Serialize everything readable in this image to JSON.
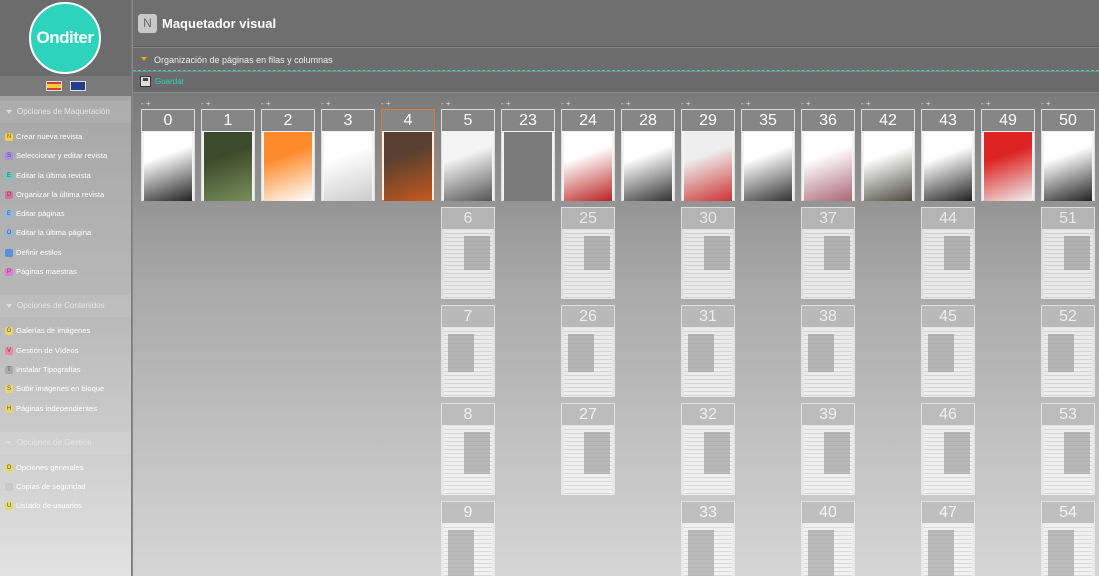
{
  "sidebar": {
    "logo_text": "Onditer",
    "sections": [
      {
        "title": "Opciones de Maquetación",
        "items": [
          {
            "label": "Crear nueva revista",
            "color": "#f1d24a",
            "glyph": "N"
          },
          {
            "label": "Seleccionar y editar revista",
            "color": "#a48fe0",
            "glyph": "S"
          },
          {
            "label": "Editar la última revista",
            "color": "#6fc7c1",
            "glyph": "E"
          },
          {
            "label": "Organizar la última revista",
            "color": "#d86fa2",
            "glyph": "O"
          },
          {
            "label": "Editar páginas",
            "color": "#8fb6e8",
            "glyph": "E"
          },
          {
            "label": "Editar la última página",
            "color": "#8fb6e8",
            "glyph": "O"
          },
          {
            "label": "Definir estilos",
            "color": "#5a8fd8",
            "glyph": ""
          },
          {
            "label": "Páginas maestras",
            "color": "#e37ad4",
            "glyph": "P"
          }
        ]
      },
      {
        "title": "Opciones de Contenidos",
        "items": [
          {
            "label": "Galerías de imágenes",
            "color": "#e8d86a",
            "glyph": "G"
          },
          {
            "label": "Gestión de Vídeos",
            "color": "#e88aa0",
            "glyph": "V"
          },
          {
            "label": "Instalar Tipografías",
            "color": "#a8a8a8",
            "glyph": "T"
          },
          {
            "label": "Subir imágenes en bloque",
            "color": "#e8d86a",
            "glyph": "S"
          },
          {
            "label": "Páginas independientes",
            "color": "#e8d86a",
            "glyph": "H"
          }
        ]
      },
      {
        "title": "Opciones de Gestión",
        "items": [
          {
            "label": "Opciones generales",
            "color": "#e8d86a",
            "glyph": "O"
          },
          {
            "label": "Copias de seguridad",
            "color": "#c8c8c8",
            "glyph": ""
          },
          {
            "label": "Listado de usuarios",
            "color": "#e8d86a",
            "glyph": "U"
          }
        ]
      }
    ]
  },
  "header": {
    "badge": "N",
    "title": "Maquetador visual"
  },
  "subheader": {
    "label": "Organización de páginas en filas y columnas"
  },
  "save_label": "Guardar",
  "add_controls": "- +",
  "columns": [
    {
      "pages": [
        "0"
      ]
    },
    {
      "pages": [
        "1"
      ]
    },
    {
      "pages": [
        "2"
      ]
    },
    {
      "pages": [
        "3"
      ]
    },
    {
      "pages": [
        "4"
      ]
    },
    {
      "pages": [
        "5",
        "6",
        "7",
        "8",
        "9"
      ]
    },
    {
      "pages": [
        "23"
      ]
    },
    {
      "pages": [
        "24",
        "25",
        "26",
        "27"
      ]
    },
    {
      "pages": [
        "28"
      ]
    },
    {
      "pages": [
        "29",
        "30",
        "31",
        "32",
        "33"
      ]
    },
    {
      "pages": [
        "35"
      ]
    },
    {
      "pages": [
        "36",
        "37",
        "38",
        "39",
        "40"
      ]
    },
    {
      "pages": [
        "42"
      ]
    },
    {
      "pages": [
        "43",
        "44",
        "45",
        "46",
        "47"
      ]
    },
    {
      "pages": [
        "49"
      ]
    },
    {
      "pages": [
        "50",
        "51",
        "52",
        "53",
        "54"
      ]
    }
  ]
}
